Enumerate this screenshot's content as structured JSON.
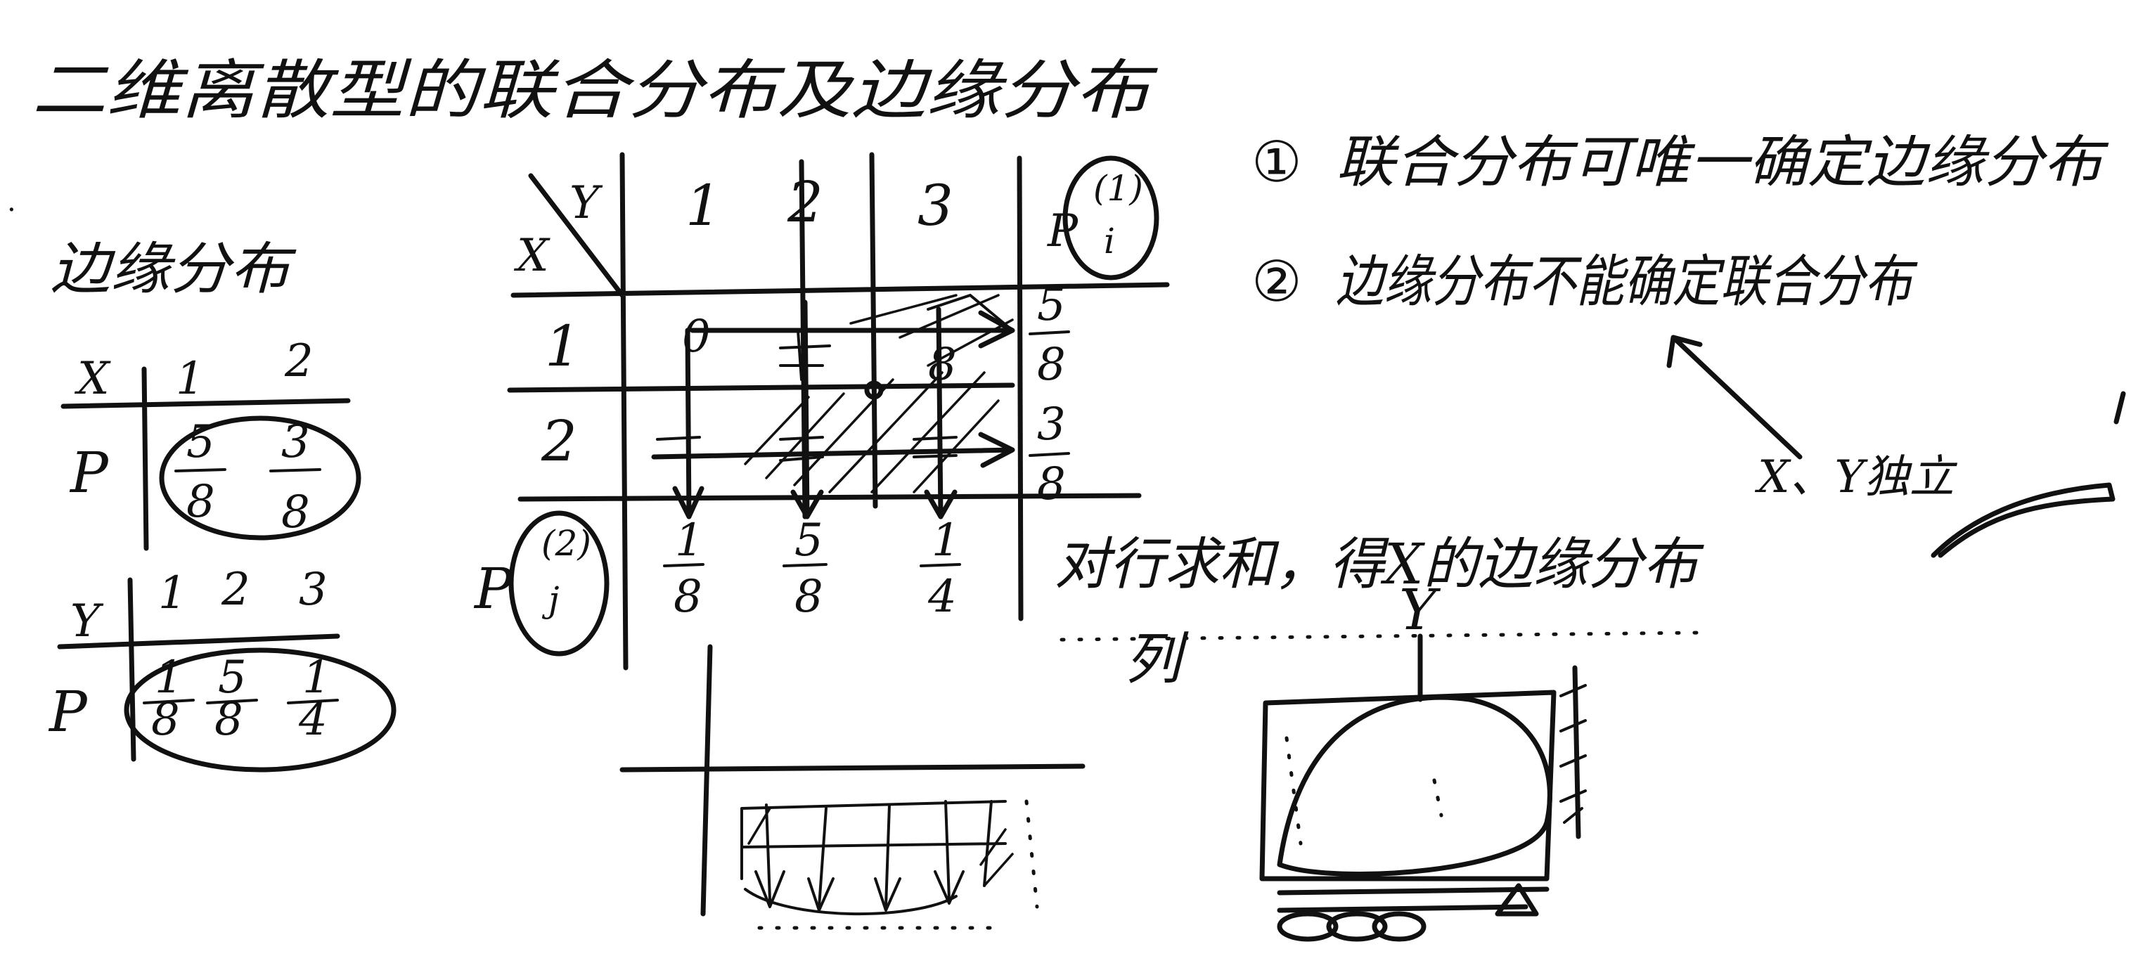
{
  "title": "二维离散型的联合分布及边缘分布",
  "notes": {
    "note1_marker": "①",
    "note1_text": "联合分布可唯一确定边缘分布",
    "note2_marker": "②",
    "note2_text": "边缘分布不能确定联合分布",
    "note3_text": "X、Y独立",
    "row_sum_note": "对行求和，得X的边缘分布",
    "col_label": "列"
  },
  "marginal": {
    "title": "边缘分布",
    "x_table": {
      "header": "X",
      "values": [
        "1",
        "2"
      ],
      "prob_label": "P",
      "probs": [
        {
          "num": "5",
          "den": "8"
        },
        {
          "num": "3",
          "den": "8"
        }
      ]
    },
    "y_table": {
      "header": "Y",
      "values": [
        "1",
        "2",
        "3"
      ],
      "prob_label": "P",
      "probs": [
        {
          "num": "1",
          "den": "8"
        },
        {
          "num": "5",
          "den": "8"
        },
        {
          "num": "1",
          "den": "4"
        }
      ]
    }
  },
  "joint": {
    "corner_x": "X",
    "corner_y": "Y",
    "cols": [
      "1",
      "2",
      "3"
    ],
    "rows": [
      "1",
      "2"
    ],
    "row_marg_label": "P",
    "row_marg_sub": "i",
    "row_marg_sup": "(1)",
    "col_marg_label": "P",
    "col_marg_sub": "j",
    "col_marg_sup": "(2)",
    "row1_cell1": "0",
    "row1_cell3": "8",
    "row_margins": [
      {
        "num": "5",
        "den": "8"
      },
      {
        "num": "3",
        "den": "8"
      }
    ],
    "col_margins": [
      {
        "num": "1",
        "den": "8"
      },
      {
        "num": "5",
        "den": "8"
      },
      {
        "num": "1",
        "den": "4"
      }
    ]
  },
  "figure_label": "Y"
}
